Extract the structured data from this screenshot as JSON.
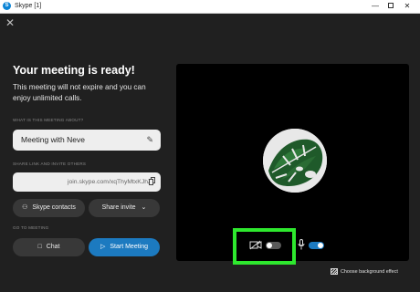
{
  "titlebar": {
    "title": "Skype [1]",
    "minimize": "—",
    "close": "✕"
  },
  "close_glyph": "✕",
  "heading": "Your meeting is ready!",
  "description": "This meeting will not expire and you can enjoy unlimited calls.",
  "about_label": "WHAT IS THIS MEETING ABOUT?",
  "meeting_name": "Meeting with Neve",
  "share_label": "SHARE LINK AND INVITE OTHERS",
  "link": "join.skype.com/xqThyMtxKJhZ",
  "skype_contacts": "Skype contacts",
  "share_invite": "Share invite",
  "go_label": "GO TO MEETING",
  "chat": "Chat",
  "start_meeting": "Start Meeting",
  "camera_enabled": false,
  "mic_enabled": true,
  "background_effect": "Choose background effect",
  "colors": {
    "accent": "#1c7ac0",
    "highlight": "#2ee82e",
    "background": "#202020"
  },
  "icons": [
    "skype-logo-icon",
    "close-icon",
    "pencil-icon",
    "copy-icon",
    "contacts-icon",
    "chevron-down-icon",
    "chat-icon",
    "video-icon",
    "camera-off-icon",
    "microphone-icon",
    "background-effect-icon"
  ]
}
